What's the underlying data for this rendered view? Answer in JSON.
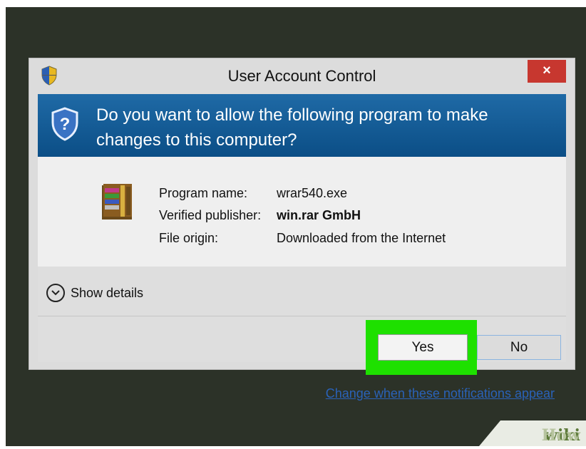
{
  "dialog": {
    "title": "User Account Control",
    "close_label": "×",
    "question": "Do you want to allow the following program to make changes to this computer?",
    "details": [
      {
        "label": "Program name:",
        "value": "wrar540.exe",
        "bold": false
      },
      {
        "label": "Verified publisher:",
        "value": "win.rar GmbH",
        "bold": true
      },
      {
        "label": "File origin:",
        "value": "Downloaded from the Internet",
        "bold": false
      }
    ],
    "show_details_label": "Show details",
    "yes_label": "Yes",
    "no_label": "No",
    "change_link": "Change when these notifications appear"
  },
  "watermark": {
    "part1": "wiki",
    "part2": "How"
  },
  "colors": {
    "header_band": "#1563a0",
    "close_button": "#c7372f",
    "highlight": "#1ee000",
    "link": "#2a62b8"
  },
  "icons": [
    "uac-shield-icon",
    "question-shield-icon",
    "winrar-icon",
    "chevron-down-icon"
  ]
}
